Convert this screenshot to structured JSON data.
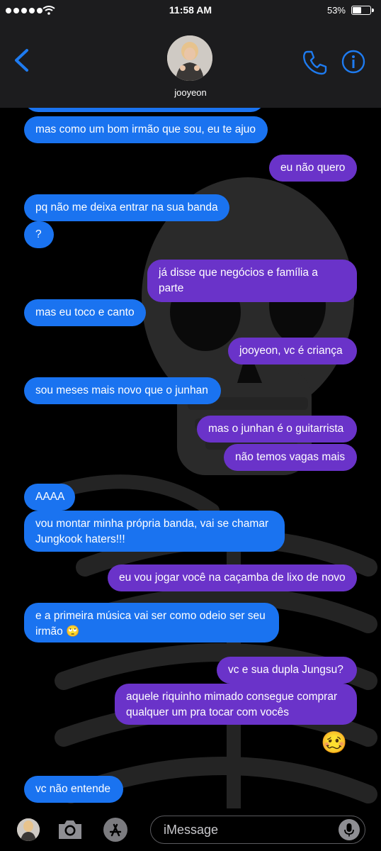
{
  "status_bar": {
    "time": "11:58 AM",
    "battery": "53%",
    "battery_level": 0.53,
    "signal_icon": "signal-dots-icon",
    "wifi_icon": "wifi-icon"
  },
  "header": {
    "contact_name": "jooyeon",
    "back_icon": "chevron-left-icon",
    "call_icon": "phone-icon",
    "info_icon": "info-icon"
  },
  "messages": [
    {
      "from": "received",
      "text": "mas como um bom irmão que sou, eu te ajuo"
    },
    {
      "from": "sent",
      "text": "eu não quero"
    },
    {
      "from": "received",
      "text": "pq não me deixa entrar na sua banda"
    },
    {
      "from": "received",
      "text": "?"
    },
    {
      "from": "sent",
      "text": "já disse que negócios e família a parte"
    },
    {
      "from": "received",
      "text": "mas eu toco e canto"
    },
    {
      "from": "sent",
      "text": "jooyeon, vc é criança"
    },
    {
      "from": "received",
      "text": "sou meses mais novo que o junhan"
    },
    {
      "from": "sent",
      "text": "mas o junhan é o guitarrista"
    },
    {
      "from": "sent",
      "text": "não temos vagas mais"
    },
    {
      "from": "received",
      "text": "AAAA"
    },
    {
      "from": "received",
      "text": "vou montar minha própria banda, vai se chamar\nJungkook haters!!!"
    },
    {
      "from": "sent",
      "text": "eu vou jogar você na caçamba de lixo de novo"
    },
    {
      "from": "received",
      "text": "e a primeira música vai ser como odeio ser seu\nirmão 🙄"
    },
    {
      "from": "sent",
      "text": "vc e sua dupla Jungsu?"
    },
    {
      "from": "sent",
      "text": "aquele riquinho mimado consegue comprar\nqualquer um pra tocar com vocês"
    },
    {
      "from": "sent",
      "text": "🥴"
    },
    {
      "from": "received",
      "text": "vc não entende"
    }
  ],
  "composer": {
    "placeholder": "iMessage",
    "camera_icon": "camera-icon",
    "apps_icon": "app-store-icon",
    "mic_icon": "microphone-icon"
  },
  "colors": {
    "received_bubble": "#1a73f0",
    "sent_bubble": "#6a33c9",
    "header_bg": "#1c1c1e",
    "background": "#000000"
  }
}
